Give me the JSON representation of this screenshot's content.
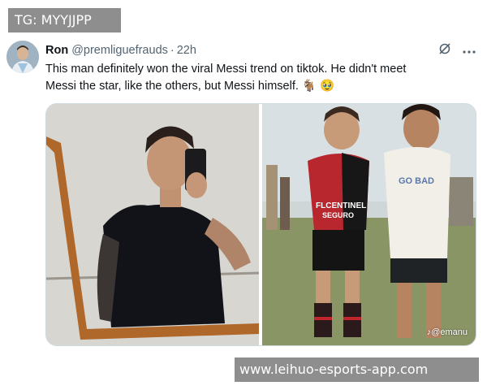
{
  "overlay": {
    "top_label": "TG: MYYJJPP",
    "bottom_label": "www.leihuo-esports-app.com"
  },
  "tweet": {
    "author_name": "Ron",
    "author_handle": "@premliguefrauds",
    "separator": "·",
    "time": "22h",
    "text_line1": "This man definitely won the viral Messi trend on tiktok. He didn't meet",
    "text_line2": "Messi the star, like the others, but Messi himself.",
    "emojis": "🐐 🥹"
  },
  "media": {
    "right_watermark": "@emanu",
    "kid_shirt_text_1": "FLCENTINEL",
    "kid_shirt_text_2": "SEGURO",
    "kid_shirt_text_3": "GO BAD"
  },
  "icons": {
    "grok": "grok-icon",
    "more": "more-icon",
    "tiktok": "tiktok-icon"
  }
}
